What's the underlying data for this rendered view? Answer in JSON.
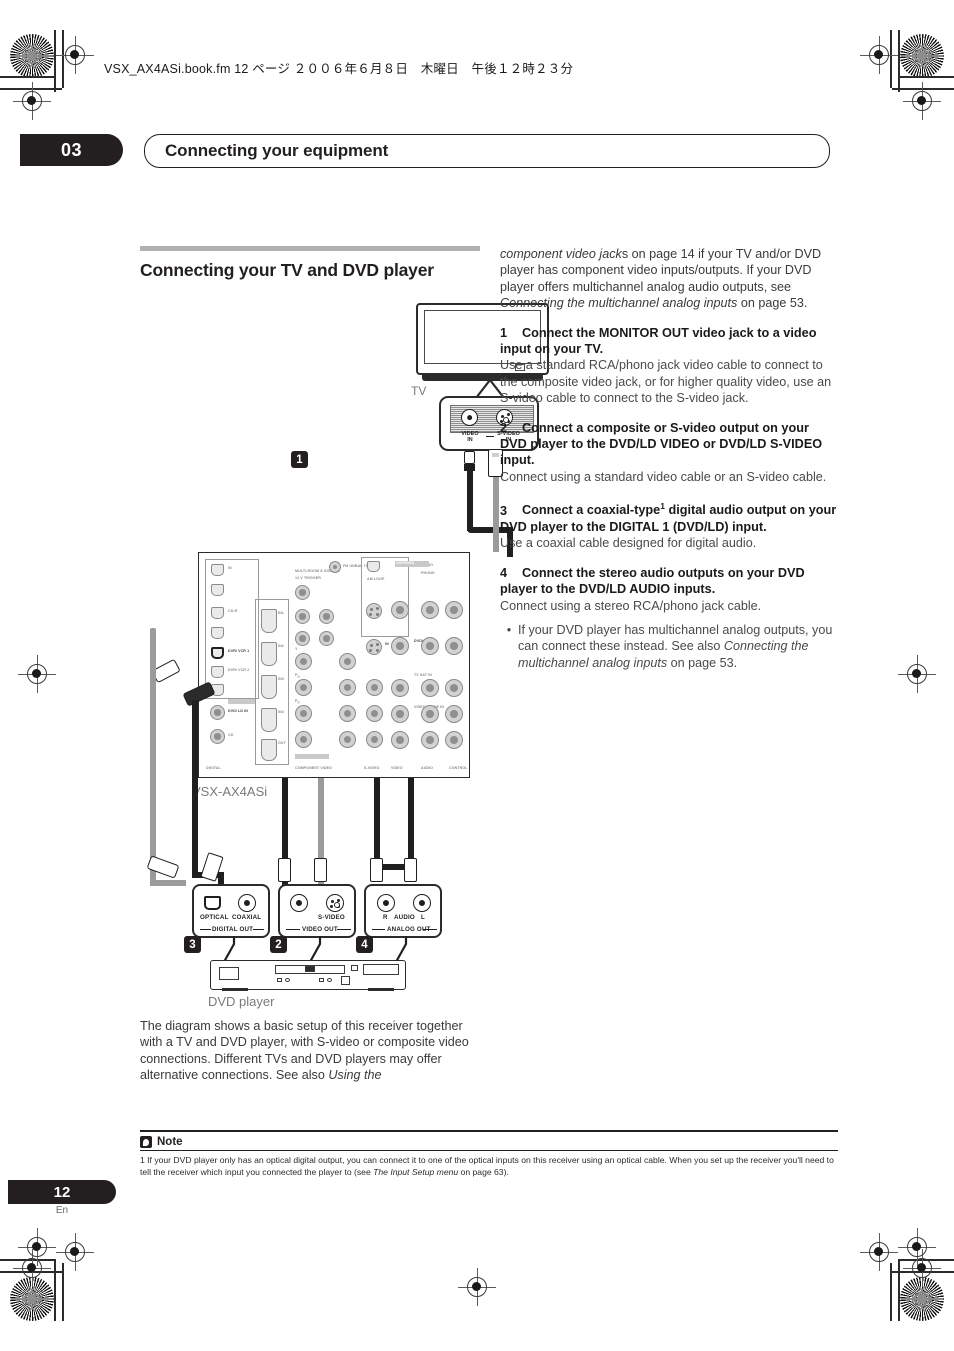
{
  "print_header": {
    "filename_line": "VSX_AX4ASi.book.fm  12 ページ  ２００６年６月８日　木曜日　午後１２時２３分"
  },
  "chapter": {
    "number": "03",
    "title": "Connecting your equipment"
  },
  "section": {
    "title": "Connecting your TV and DVD player"
  },
  "left_column": {
    "closing_paragraph_part1": "The diagram shows a basic setup of this receiver together with a TV and DVD player, with S-video or composite video connections. Different TVs and DVD players may offer alternative connections. See also ",
    "closing_paragraph_italic": "Using the"
  },
  "right_column": {
    "intro_italic_1": "component video jack",
    "intro_text_1": "s on page 14 if your TV and/or DVD player has component video inputs/outputs. If your DVD player offers multichannel analog audio outputs, see ",
    "intro_italic_2": "Connecting the multichannel analog inputs",
    "intro_text_2": " on page 53.",
    "steps": [
      {
        "num": "1",
        "heading": "Connect the MONITOR OUT video jack to a video input on your TV.",
        "body": "Use a standard RCA/phono jack video cable to connect to the composite video jack, or for higher quality video, use an S-video cable to connect to the S-video jack."
      },
      {
        "num": "2",
        "heading": "Connect a composite or S-video output on your DVD player to the DVD/LD VIDEO or DVD/LD S-VIDEO input.",
        "body": "Connect using a standard video cable or an S-video cable."
      },
      {
        "num": "3",
        "heading_before_sup": "Connect a coaxial-type",
        "heading_sup": "1",
        "heading_after_sup": " digital audio output on your DVD player to the DIGITAL 1 (DVD/LD) input.",
        "body": "Use a coaxial cable designed for digital audio."
      },
      {
        "num": "4",
        "heading": "Connect the stereo audio outputs on your DVD player to the DVD/LD AUDIO inputs.",
        "body": "Connect using a stereo RCA/phono jack cable."
      }
    ],
    "bullet": {
      "marker": "•",
      "text_1": "If your DVD player has multichannel analog outputs, you can connect these instead. See also ",
      "italic": "Connecting the multichannel analog inputs",
      "text_2": " on page 53."
    }
  },
  "diagram": {
    "tv_label": "TV",
    "tv_jacks": {
      "video_in_line1": "VIDEO",
      "video_in_line2": "IN",
      "svideo_in_line1": "S-VIDEO",
      "svideo_in_line2": "IN"
    },
    "receiver_label": "VSX-AX4ASi",
    "receiver_panel_text": {
      "digital": "DIGITAL",
      "component_video": "COMPONENT VIDEO",
      "assignable": "ASSIGNABLE",
      "s_video": "S-VIDEO",
      "video": "VIDEO",
      "audio": "AUDIO",
      "control": "CONTROL",
      "antenna": "ANTENNA",
      "am_loop": "AM LOOP",
      "fm_unbal_75": "FM UNBAL 75",
      "trigger": "12 V TRIGGER",
      "monitor_out": "MONITOR OUT",
      "multiroom": "MULTI-ROOM & SOURCE",
      "dvd_ld_in": "DVD/ LD IN",
      "tv_sat_in": "TV SAT IN",
      "dvr_vcr1": "DVR/ VCR 1",
      "dvr_vcr2": "DVR/ VCR 2",
      "video_game_in": "VIDEO/ GAME IN",
      "cd_r": "CD-R",
      "cd": "CD",
      "phono": "PHONO",
      "sub_in": "SUB IN",
      "out": "OUT",
      "in": "IN"
    },
    "dvd_connectors": [
      {
        "group": "DIGITAL OUT",
        "jacks": [
          "OPTICAL",
          "COAXIAL"
        ],
        "callout": "3"
      },
      {
        "group": "VIDEO OUT",
        "jacks": [
          "",
          "S-VIDEO"
        ],
        "callout": "2"
      },
      {
        "group": "ANALOG OUT",
        "jacks": [
          "R",
          "AUDIO",
          "L"
        ],
        "callout": "4"
      }
    ],
    "tv_callout": "1",
    "dvd_label": "DVD player"
  },
  "note": {
    "title": "Note",
    "text_1": "1 If your DVD player only has an optical digital output, you can connect it to one of the optical inputs on this receiver using an optical cable. When you set up the receiver you'll need to tell the receiver which input you connected the player to (see ",
    "italic": "The Input Setup menu",
    "text_2": " on page 63)."
  },
  "footer": {
    "page_number": "12",
    "language": "En"
  },
  "colors": {
    "ink": "#231f20",
    "body_gray": "#3a3a3a",
    "rule_gray": "#b0b0b0",
    "panel_gray": "#9b9b9b"
  }
}
